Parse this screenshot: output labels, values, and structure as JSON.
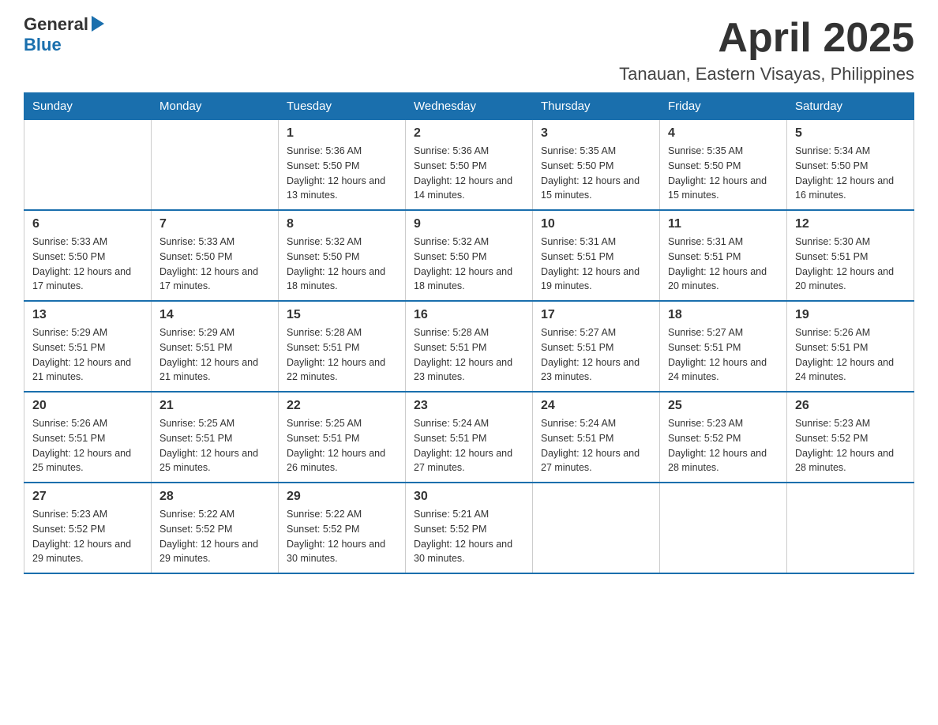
{
  "logo": {
    "general": "General",
    "blue": "Blue",
    "arrow": "▶"
  },
  "title": "April 2025",
  "subtitle": "Tanauan, Eastern Visayas, Philippines",
  "headers": [
    "Sunday",
    "Monday",
    "Tuesday",
    "Wednesday",
    "Thursday",
    "Friday",
    "Saturday"
  ],
  "weeks": [
    [
      {
        "day": "",
        "sunrise": "",
        "sunset": "",
        "daylight": ""
      },
      {
        "day": "",
        "sunrise": "",
        "sunset": "",
        "daylight": ""
      },
      {
        "day": "1",
        "sunrise": "Sunrise: 5:36 AM",
        "sunset": "Sunset: 5:50 PM",
        "daylight": "Daylight: 12 hours and 13 minutes."
      },
      {
        "day": "2",
        "sunrise": "Sunrise: 5:36 AM",
        "sunset": "Sunset: 5:50 PM",
        "daylight": "Daylight: 12 hours and 14 minutes."
      },
      {
        "day": "3",
        "sunrise": "Sunrise: 5:35 AM",
        "sunset": "Sunset: 5:50 PM",
        "daylight": "Daylight: 12 hours and 15 minutes."
      },
      {
        "day": "4",
        "sunrise": "Sunrise: 5:35 AM",
        "sunset": "Sunset: 5:50 PM",
        "daylight": "Daylight: 12 hours and 15 minutes."
      },
      {
        "day": "5",
        "sunrise": "Sunrise: 5:34 AM",
        "sunset": "Sunset: 5:50 PM",
        "daylight": "Daylight: 12 hours and 16 minutes."
      }
    ],
    [
      {
        "day": "6",
        "sunrise": "Sunrise: 5:33 AM",
        "sunset": "Sunset: 5:50 PM",
        "daylight": "Daylight: 12 hours and 17 minutes."
      },
      {
        "day": "7",
        "sunrise": "Sunrise: 5:33 AM",
        "sunset": "Sunset: 5:50 PM",
        "daylight": "Daylight: 12 hours and 17 minutes."
      },
      {
        "day": "8",
        "sunrise": "Sunrise: 5:32 AM",
        "sunset": "Sunset: 5:50 PM",
        "daylight": "Daylight: 12 hours and 18 minutes."
      },
      {
        "day": "9",
        "sunrise": "Sunrise: 5:32 AM",
        "sunset": "Sunset: 5:50 PM",
        "daylight": "Daylight: 12 hours and 18 minutes."
      },
      {
        "day": "10",
        "sunrise": "Sunrise: 5:31 AM",
        "sunset": "Sunset: 5:51 PM",
        "daylight": "Daylight: 12 hours and 19 minutes."
      },
      {
        "day": "11",
        "sunrise": "Sunrise: 5:31 AM",
        "sunset": "Sunset: 5:51 PM",
        "daylight": "Daylight: 12 hours and 20 minutes."
      },
      {
        "day": "12",
        "sunrise": "Sunrise: 5:30 AM",
        "sunset": "Sunset: 5:51 PM",
        "daylight": "Daylight: 12 hours and 20 minutes."
      }
    ],
    [
      {
        "day": "13",
        "sunrise": "Sunrise: 5:29 AM",
        "sunset": "Sunset: 5:51 PM",
        "daylight": "Daylight: 12 hours and 21 minutes."
      },
      {
        "day": "14",
        "sunrise": "Sunrise: 5:29 AM",
        "sunset": "Sunset: 5:51 PM",
        "daylight": "Daylight: 12 hours and 21 minutes."
      },
      {
        "day": "15",
        "sunrise": "Sunrise: 5:28 AM",
        "sunset": "Sunset: 5:51 PM",
        "daylight": "Daylight: 12 hours and 22 minutes."
      },
      {
        "day": "16",
        "sunrise": "Sunrise: 5:28 AM",
        "sunset": "Sunset: 5:51 PM",
        "daylight": "Daylight: 12 hours and 23 minutes."
      },
      {
        "day": "17",
        "sunrise": "Sunrise: 5:27 AM",
        "sunset": "Sunset: 5:51 PM",
        "daylight": "Daylight: 12 hours and 23 minutes."
      },
      {
        "day": "18",
        "sunrise": "Sunrise: 5:27 AM",
        "sunset": "Sunset: 5:51 PM",
        "daylight": "Daylight: 12 hours and 24 minutes."
      },
      {
        "day": "19",
        "sunrise": "Sunrise: 5:26 AM",
        "sunset": "Sunset: 5:51 PM",
        "daylight": "Daylight: 12 hours and 24 minutes."
      }
    ],
    [
      {
        "day": "20",
        "sunrise": "Sunrise: 5:26 AM",
        "sunset": "Sunset: 5:51 PM",
        "daylight": "Daylight: 12 hours and 25 minutes."
      },
      {
        "day": "21",
        "sunrise": "Sunrise: 5:25 AM",
        "sunset": "Sunset: 5:51 PM",
        "daylight": "Daylight: 12 hours and 25 minutes."
      },
      {
        "day": "22",
        "sunrise": "Sunrise: 5:25 AM",
        "sunset": "Sunset: 5:51 PM",
        "daylight": "Daylight: 12 hours and 26 minutes."
      },
      {
        "day": "23",
        "sunrise": "Sunrise: 5:24 AM",
        "sunset": "Sunset: 5:51 PM",
        "daylight": "Daylight: 12 hours and 27 minutes."
      },
      {
        "day": "24",
        "sunrise": "Sunrise: 5:24 AM",
        "sunset": "Sunset: 5:51 PM",
        "daylight": "Daylight: 12 hours and 27 minutes."
      },
      {
        "day": "25",
        "sunrise": "Sunrise: 5:23 AM",
        "sunset": "Sunset: 5:52 PM",
        "daylight": "Daylight: 12 hours and 28 minutes."
      },
      {
        "day": "26",
        "sunrise": "Sunrise: 5:23 AM",
        "sunset": "Sunset: 5:52 PM",
        "daylight": "Daylight: 12 hours and 28 minutes."
      }
    ],
    [
      {
        "day": "27",
        "sunrise": "Sunrise: 5:23 AM",
        "sunset": "Sunset: 5:52 PM",
        "daylight": "Daylight: 12 hours and 29 minutes."
      },
      {
        "day": "28",
        "sunrise": "Sunrise: 5:22 AM",
        "sunset": "Sunset: 5:52 PM",
        "daylight": "Daylight: 12 hours and 29 minutes."
      },
      {
        "day": "29",
        "sunrise": "Sunrise: 5:22 AM",
        "sunset": "Sunset: 5:52 PM",
        "daylight": "Daylight: 12 hours and 30 minutes."
      },
      {
        "day": "30",
        "sunrise": "Sunrise: 5:21 AM",
        "sunset": "Sunset: 5:52 PM",
        "daylight": "Daylight: 12 hours and 30 minutes."
      },
      {
        "day": "",
        "sunrise": "",
        "sunset": "",
        "daylight": ""
      },
      {
        "day": "",
        "sunrise": "",
        "sunset": "",
        "daylight": ""
      },
      {
        "day": "",
        "sunrise": "",
        "sunset": "",
        "daylight": ""
      }
    ]
  ]
}
